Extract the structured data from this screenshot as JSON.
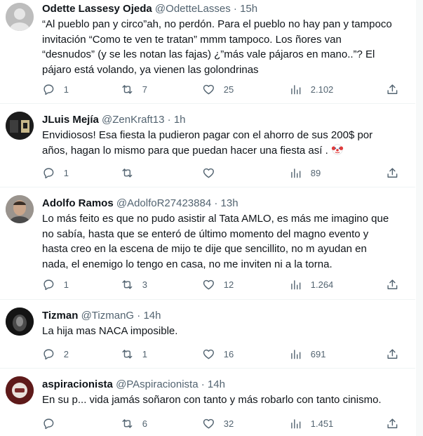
{
  "tweets": [
    {
      "name": "Odette Lassesy Ojeda",
      "handle": "@OdetteLasses",
      "time": "15h",
      "lines": [
        "“Al pueblo pan y circo”ah, no perdón. Para el pueblo no hay pan y tampoco",
        "invitación “Como te ven te tratan” mmm tampoco. Los ñores van",
        "“desnudos” (y se les notan las fajas) ¿”más vale pájaros en mano..”? El",
        "pájaro está volando, ya vienen las golondrinas"
      ],
      "replies": "1",
      "retweets": "7",
      "likes": "25",
      "views": "2.102",
      "avatar_color": "#c9c9c9"
    },
    {
      "name": "JLuis Mejía",
      "handle": "@ZenKraft13",
      "time": "1h",
      "lines": [
        "Envidiosos! Esa fiesta la pudieron pagar con el ahorro de sus 200$ por",
        "años, hagan lo mismo para que puedan hacer una fiesta así ."
      ],
      "replies": "1",
      "retweets": "",
      "likes": "",
      "views": "89",
      "emoji": "clown-face",
      "avatar_color": "#2b2b2b"
    },
    {
      "name": "Adolfo Ramos",
      "handle": "@AdolfoR27423884",
      "time": "13h",
      "lines": [
        "Lo más feito es que no pudo asistir al Tata AMLO, es más me imagino que",
        "no sabía, hasta que se enteró de último momento del magno evento y",
        "hasta creo en la escena de mijo te dije que sencillito, no m ayudan en",
        "nada, el enemigo lo tengo en casa, no me inviten ni a la torna."
      ],
      "replies": "1",
      "retweets": "3",
      "likes": "12",
      "views": "1.264",
      "avatar_color": "#8a7f76"
    },
    {
      "name": "Tizman",
      "handle": "@TizmanG",
      "time": "14h",
      "lines": [
        "La hija mas NACA imposible."
      ],
      "replies": "2",
      "retweets": "1",
      "likes": "16",
      "views": "691",
      "avatar_color": "#1a1a1a"
    },
    {
      "name": "aspiracionista",
      "handle": "@PAspiracionista",
      "time": "14h",
      "lines": [
        "En su p... vida jamás soñaron con tanto y más robarlo con tanto cinismo."
      ],
      "replies": "",
      "retweets": "6",
      "likes": "32",
      "views": "1.451",
      "avatar_color": "#6b1f1f"
    }
  ],
  "separator": "·",
  "icons": {
    "reply": "reply-icon",
    "retweet": "retweet-icon",
    "like": "heart-icon",
    "views": "views-icon",
    "share": "share-icon"
  },
  "colors": {
    "text": "#0f1419",
    "secondary": "#536471",
    "divider": "#eff3f4"
  }
}
